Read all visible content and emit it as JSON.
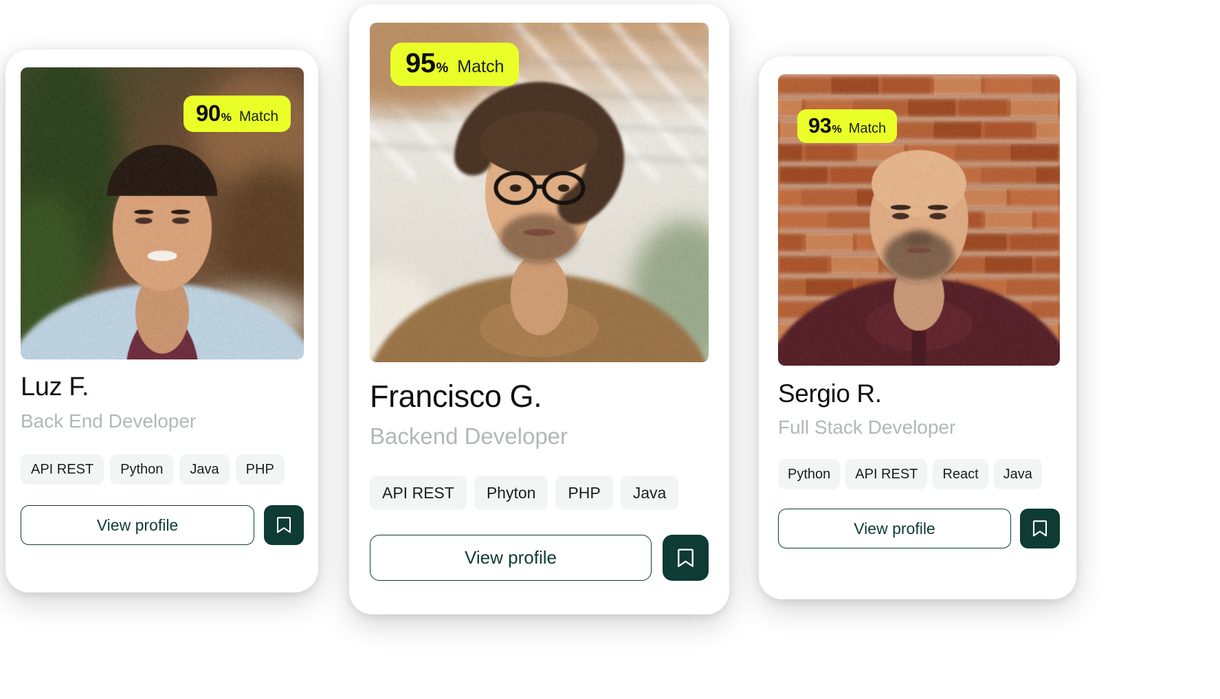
{
  "theme": {
    "badge_bg": "#eaff27",
    "badge_text": "#0d0d0d",
    "accent_dark": "#0e3b33",
    "tag_bg": "#f3f4f4",
    "role_text": "#b2b8b6",
    "name_text": "#101010",
    "card_bg": "#ffffff",
    "page_bg": "#ffffff"
  },
  "common": {
    "match_word": "Match",
    "percent_symbol": "%",
    "view_profile_label": "View profile",
    "bookmark_icon": "bookmark-icon"
  },
  "cards": [
    {
      "id": "card-1",
      "match_value": "90",
      "percent_symbol": "%",
      "match_word": "Match",
      "name": "Luz F.",
      "role": "Back End Developer",
      "tags": [
        "API REST",
        "Python",
        "Java",
        "PHP"
      ],
      "view_profile_label": "View profile",
      "bookmark_icon": "bookmark-icon",
      "photo_alt": "portrait-luz-f"
    },
    {
      "id": "card-2",
      "match_value": "95",
      "percent_symbol": "%",
      "match_word": "Match",
      "name": "Francisco G.",
      "role": "Backend Developer",
      "tags": [
        "API REST",
        "Phyton",
        "PHP",
        "Java"
      ],
      "view_profile_label": "View profile",
      "bookmark_icon": "bookmark-icon",
      "photo_alt": "portrait-francisco-g"
    },
    {
      "id": "card-3",
      "match_value": "93",
      "percent_symbol": "%",
      "match_word": "Match",
      "name": "Sergio R.",
      "role": "Full Stack Developer",
      "tags": [
        "Python",
        "API REST",
        "React",
        "Java"
      ],
      "view_profile_label": "View profile",
      "bookmark_icon": "bookmark-icon",
      "photo_alt": "portrait-sergio-r"
    }
  ]
}
